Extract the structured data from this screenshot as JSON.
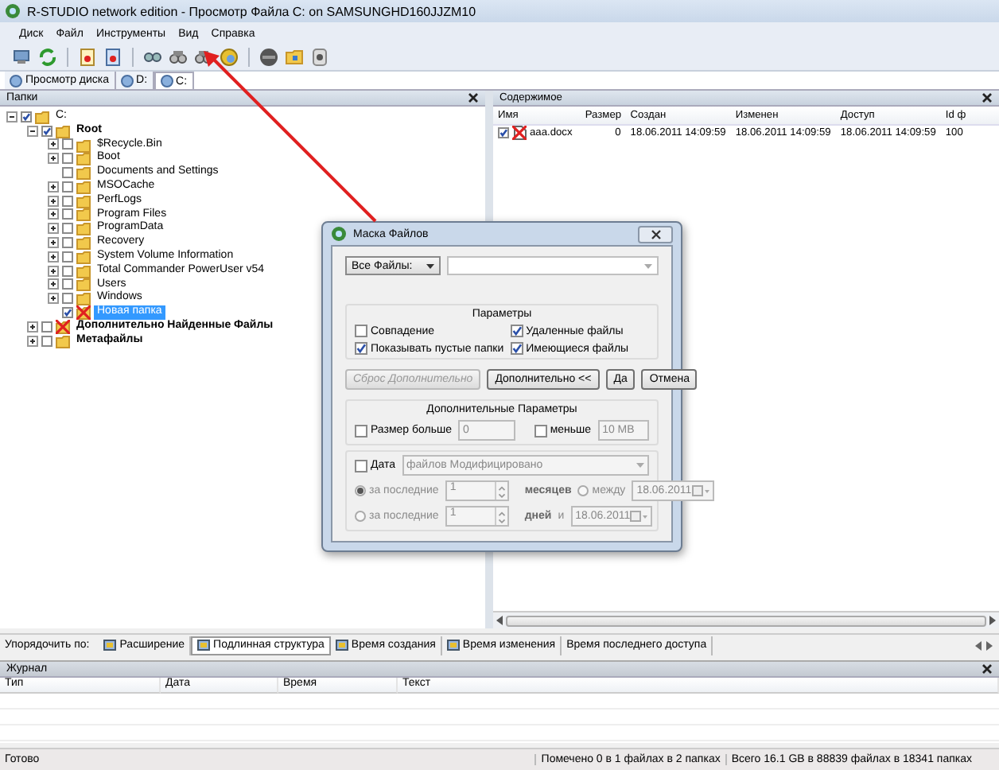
{
  "window": {
    "title": "R-STUDIO network edition - Просмотр Файла C: on SAMSUNGHD160JJZM10"
  },
  "menu": [
    "Диск",
    "Файл",
    "Инструменты",
    "Вид",
    "Справка"
  ],
  "view_tabs": [
    {
      "label": "Просмотр диска",
      "selected": false
    },
    {
      "label": "D:",
      "selected": false
    },
    {
      "label": "C:",
      "selected": true
    }
  ],
  "folders_panel": {
    "title": "Папки",
    "tree": [
      {
        "label": "C:",
        "kind": "folder",
        "expandable": true,
        "checked": true,
        "selected": false,
        "children": [
          {
            "label": "Root",
            "kind": "folder",
            "expandable": true,
            "checked": true,
            "selected": false,
            "children": [
              {
                "label": "$Recycle.Bin",
                "kind": "folder",
                "expandable": true,
                "checked": false,
                "selected": false
              },
              {
                "label": "Boot",
                "kind": "folder",
                "expandable": true,
                "checked": false,
                "selected": false
              },
              {
                "label": "Documents and Settings",
                "kind": "folder",
                "expandable": false,
                "checked": false,
                "selected": false
              },
              {
                "label": "MSOCache",
                "kind": "folder",
                "expandable": true,
                "checked": false,
                "selected": false
              },
              {
                "label": "PerfLogs",
                "kind": "folder",
                "expandable": true,
                "checked": false,
                "selected": false
              },
              {
                "label": "Program Files",
                "kind": "folder",
                "expandable": true,
                "checked": false,
                "selected": false
              },
              {
                "label": "ProgramData",
                "kind": "folder",
                "expandable": true,
                "checked": false,
                "selected": false
              },
              {
                "label": "Recovery",
                "kind": "folder",
                "expandable": true,
                "checked": false,
                "selected": false
              },
              {
                "label": "System Volume Information",
                "kind": "folder",
                "expandable": true,
                "checked": false,
                "selected": false
              },
              {
                "label": "Total Commander PowerUser v54",
                "kind": "folder",
                "expandable": true,
                "checked": false,
                "selected": false
              },
              {
                "label": "Users",
                "kind": "folder",
                "expandable": true,
                "checked": false,
                "selected": false
              },
              {
                "label": "Windows",
                "kind": "folder",
                "expandable": true,
                "checked": false,
                "selected": false
              },
              {
                "label": "Новая папка",
                "kind": "deleted",
                "expandable": false,
                "checked": true,
                "selected": true
              }
            ]
          },
          {
            "label": "Дополнительно Найденные Файлы",
            "kind": "deleted",
            "expandable": true,
            "checked": false,
            "selected": false
          },
          {
            "label": "Метафайлы",
            "kind": "folder",
            "expandable": true,
            "checked": false,
            "selected": false
          }
        ]
      }
    ]
  },
  "contents_panel": {
    "title": "Содержимое",
    "columns": [
      "Имя",
      "Размер",
      "Создан",
      "Изменен",
      "Доступ",
      "Id ф"
    ],
    "rows": [
      {
        "checked": true,
        "kind": "deleted",
        "cells": [
          "aaa.docx",
          "0",
          "18.06.2011 14:09:59",
          "18.06.2011 14:09:59",
          "18.06.2011 14:09:59",
          "100"
        ]
      }
    ]
  },
  "sort_bar": {
    "label": "Упорядочить по:",
    "tabs": [
      {
        "label": "Расширение",
        "icon": true,
        "selected": false
      },
      {
        "label": "Подлинная структура",
        "icon": true,
        "selected": true
      },
      {
        "label": "Время создания",
        "icon": true,
        "selected": false
      },
      {
        "label": "Время изменения",
        "icon": true,
        "selected": false
      },
      {
        "label": "Время последнего доступа",
        "icon": false,
        "selected": false
      }
    ]
  },
  "journal": {
    "title": "Журнал",
    "columns": [
      "Тип",
      "Дата",
      "Время",
      "Текст"
    ]
  },
  "status_bar": [
    "Готово",
    "Помечено 0 в 1 файлах в 2 папках",
    "Всего 16.1 GB в 88839 файлах в 18341 папках"
  ],
  "dialog": {
    "title": "Маска Файлов",
    "filter": "Все Файлы:",
    "parameters": {
      "title": "Параметры",
      "options": [
        {
          "label": "Совпадение",
          "checked": false
        },
        {
          "label": "Удаленные файлы",
          "checked": true
        },
        {
          "label": "Показывать пустые папки",
          "checked": true
        },
        {
          "label": "Имеющиеся файлы",
          "checked": true
        }
      ]
    },
    "buttons": [
      {
        "label": "Сброс Дополнительно",
        "disabled": true
      },
      {
        "label": "Дополнительно <<",
        "disabled": false
      },
      {
        "label": "Да",
        "disabled": false
      },
      {
        "label": "Отмена",
        "disabled": false
      }
    ],
    "extra": {
      "title": "Дополнительные Параметры",
      "size_more": {
        "label": "Размер больше",
        "checked": false,
        "value": "0"
      },
      "size_less": {
        "label": "меньше",
        "checked": false,
        "value": "10 MB"
      },
      "date": {
        "label": "Дата",
        "checked": false,
        "disabled": true,
        "mode": "файлов Модифицировано",
        "rows": [
          {
            "label": "за последние",
            "selected": true,
            "value": "1",
            "unit": "месяцев",
            "range_label": "между",
            "range_selected": false,
            "date": "18.06.2011"
          },
          {
            "label": "за последние",
            "selected": false,
            "value": "1",
            "unit": "дней",
            "range_label": "и",
            "date": "18.06.2011"
          }
        ]
      }
    }
  }
}
